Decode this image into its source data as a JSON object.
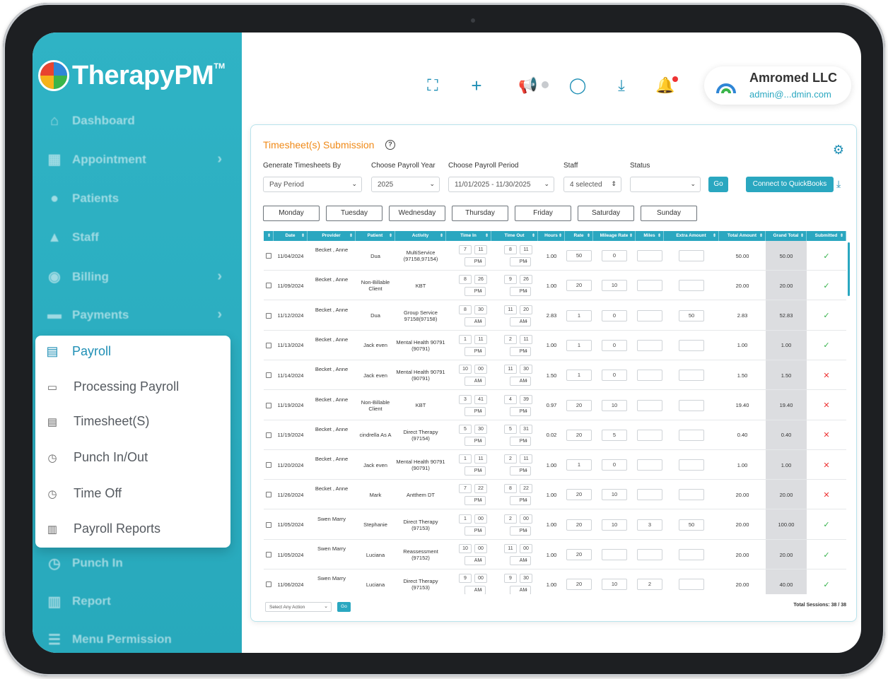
{
  "brand": {
    "name": "TherapyPM",
    "tm": "TM"
  },
  "sidebar": {
    "items": [
      {
        "label": "Dashboard",
        "icon": "home-icon"
      },
      {
        "label": "Appointment",
        "icon": "calendar-icon",
        "chevron": true
      },
      {
        "label": "Patients",
        "icon": "users-icon"
      },
      {
        "label": "Staff",
        "icon": "staff-icon"
      },
      {
        "label": "Billing",
        "icon": "billing-icon",
        "chevron": true
      },
      {
        "label": "Payments",
        "icon": "card-icon",
        "chevron": true
      },
      {
        "label": "Punch In",
        "icon": "clock-icon"
      },
      {
        "label": "Report",
        "icon": "chart-icon"
      },
      {
        "label": "Menu Permission",
        "icon": "menu-icon"
      }
    ],
    "payroll_menu": {
      "title": "Payroll",
      "items": [
        {
          "label": "Processing Payroll"
        },
        {
          "label": "Timesheet(S)"
        },
        {
          "label": "Punch In/Out"
        },
        {
          "label": "Time Off"
        },
        {
          "label": "Payroll Reports"
        }
      ]
    }
  },
  "account": {
    "name": "Amromed LLC",
    "email": "admin@...dmin.com"
  },
  "card": {
    "title": "Timesheet(s) Submission",
    "filters": {
      "generate_label": "Generate Timesheets By",
      "generate_value": "Pay Period",
      "year_label": "Choose Payroll Year",
      "year_value": "2025",
      "period_label": "Choose Payroll Period",
      "period_value": "11/01/2025 - 11/30/2025",
      "staff_label": "Staff",
      "staff_value": "4 selected",
      "status_label": "Status",
      "status_value": "",
      "go_label": "Go",
      "qb_label": "Connect to QuickBooks"
    },
    "days": [
      "Monday",
      "Tuesday",
      "Wednesday",
      "Thursday",
      "Friday",
      "Saturday",
      "Sunday"
    ],
    "columns": [
      "Date",
      "Provider",
      "Patient",
      "Activity",
      "Time In",
      "Time Out",
      "Hours",
      "Rate",
      "Mileage Rate",
      "Miles",
      "Extra Amount",
      "Total Amount",
      "Grand Total",
      "Submitted"
    ],
    "rows": [
      {
        "date": "11/04/2024",
        "provider": "Becket , Anne",
        "patient": "Dua",
        "activity": "MultiService (97158,97154)",
        "in_h": "7",
        "in_m": "11",
        "in_ap": "PM",
        "out_h": "8",
        "out_m": "11",
        "out_ap": "PM",
        "hours": "1.00",
        "rate": "50",
        "mileage": "0",
        "miles": "",
        "extra": "",
        "total": "50.00",
        "grand": "50.00",
        "submitted": "yes"
      },
      {
        "date": "11/09/2024",
        "provider": "Becket , Anne",
        "patient": "Non-Billable Client",
        "activity": "KBT",
        "in_h": "8",
        "in_m": "26",
        "in_ap": "PM",
        "out_h": "9",
        "out_m": "26",
        "out_ap": "PM",
        "hours": "1.00",
        "rate": "20",
        "mileage": "10",
        "miles": "",
        "extra": "",
        "total": "20.00",
        "grand": "20.00",
        "submitted": "yes"
      },
      {
        "date": "11/12/2024",
        "provider": "Becket , Anne",
        "patient": "Dua",
        "activity": "Group Service 97158(97158)",
        "in_h": "8",
        "in_m": "30",
        "in_ap": "AM",
        "out_h": "11",
        "out_m": "20",
        "out_ap": "AM",
        "hours": "2.83",
        "rate": "1",
        "mileage": "0",
        "miles": "",
        "extra": "50",
        "total": "2.83",
        "grand": "52.83",
        "submitted": "yes"
      },
      {
        "date": "11/13/2024",
        "provider": "Becket , Anne",
        "patient": "Jack even",
        "activity": "Mental Health 90791 (90791)",
        "in_h": "1",
        "in_m": "11",
        "in_ap": "PM",
        "out_h": "2",
        "out_m": "11",
        "out_ap": "PM",
        "hours": "1.00",
        "rate": "1",
        "mileage": "0",
        "miles": "",
        "extra": "",
        "total": "1.00",
        "grand": "1.00",
        "submitted": "yes"
      },
      {
        "date": "11/14/2024",
        "provider": "Becket , Anne",
        "patient": "Jack even",
        "activity": "Mental Health 90791 (90791)",
        "in_h": "10",
        "in_m": "00",
        "in_ap": "AM",
        "out_h": "11",
        "out_m": "30",
        "out_ap": "AM",
        "hours": "1.50",
        "rate": "1",
        "mileage": "0",
        "miles": "",
        "extra": "",
        "total": "1.50",
        "grand": "1.50",
        "submitted": "no"
      },
      {
        "date": "11/19/2024",
        "provider": "Becket , Anne",
        "patient": "Non-Billable Client",
        "activity": "KBT",
        "in_h": "3",
        "in_m": "41",
        "in_ap": "PM",
        "out_h": "4",
        "out_m": "39",
        "out_ap": "PM",
        "hours": "0.97",
        "rate": "20",
        "mileage": "10",
        "miles": "",
        "extra": "",
        "total": "19.40",
        "grand": "19.40",
        "submitted": "no"
      },
      {
        "date": "11/19/2024",
        "provider": "Becket , Anne",
        "patient": "cindrella As A",
        "activity": "Direct Therapy (97154)",
        "in_h": "5",
        "in_m": "30",
        "in_ap": "PM",
        "out_h": "5",
        "out_m": "31",
        "out_ap": "PM",
        "hours": "0.02",
        "rate": "20",
        "mileage": "5",
        "miles": "",
        "extra": "",
        "total": "0.40",
        "grand": "0.40",
        "submitted": "no"
      },
      {
        "date": "11/20/2024",
        "provider": "Becket , Anne",
        "patient": "Jack even",
        "activity": "Mental Health 90791 (90791)",
        "in_h": "1",
        "in_m": "11",
        "in_ap": "PM",
        "out_h": "2",
        "out_m": "11",
        "out_ap": "PM",
        "hours": "1.00",
        "rate": "1",
        "mileage": "0",
        "miles": "",
        "extra": "",
        "total": "1.00",
        "grand": "1.00",
        "submitted": "no"
      },
      {
        "date": "11/26/2024",
        "provider": "Becket , Anne",
        "patient": "Mark",
        "activity": "Antthem DT",
        "in_h": "7",
        "in_m": "22",
        "in_ap": "PM",
        "out_h": "8",
        "out_m": "22",
        "out_ap": "PM",
        "hours": "1.00",
        "rate": "20",
        "mileage": "10",
        "miles": "",
        "extra": "",
        "total": "20.00",
        "grand": "20.00",
        "submitted": "no"
      },
      {
        "date": "11/05/2024",
        "provider": "Swen Marry",
        "patient": "Stephanie",
        "activity": "Direct Therapy (97153)",
        "in_h": "1",
        "in_m": "00",
        "in_ap": "PM",
        "out_h": "2",
        "out_m": "00",
        "out_ap": "PM",
        "hours": "1.00",
        "rate": "20",
        "mileage": "10",
        "miles": "3",
        "extra": "50",
        "total": "20.00",
        "grand": "100.00",
        "submitted": "yes"
      },
      {
        "date": "11/05/2024",
        "provider": "Swen Marry",
        "patient": "Luciana",
        "activity": "Reassessment (97152)",
        "in_h": "10",
        "in_m": "00",
        "in_ap": "AM",
        "out_h": "11",
        "out_m": "00",
        "out_ap": "AM",
        "hours": "1.00",
        "rate": "20",
        "mileage": "",
        "miles": "",
        "extra": "",
        "total": "20.00",
        "grand": "20.00",
        "submitted": "yes"
      },
      {
        "date": "11/06/2024",
        "provider": "Swen Marry",
        "patient": "Luciana",
        "activity": "Direct Therapy (97153)",
        "in_h": "9",
        "in_m": "00",
        "in_ap": "AM",
        "out_h": "9",
        "out_m": "30",
        "out_ap": "AM",
        "hours": "1.00",
        "rate": "20",
        "mileage": "10",
        "miles": "2",
        "extra": "",
        "total": "20.00",
        "grand": "40.00",
        "submitted": "yes"
      }
    ],
    "footer": {
      "action_placeholder": "Select Any Action",
      "go_label": "Go",
      "total_sessions": "Total Sessions: 38 / 38"
    }
  },
  "colors": {
    "brand": "#2fb3c5",
    "accent": "#f08a18",
    "ok": "#35b24a",
    "error": "#e33333"
  }
}
